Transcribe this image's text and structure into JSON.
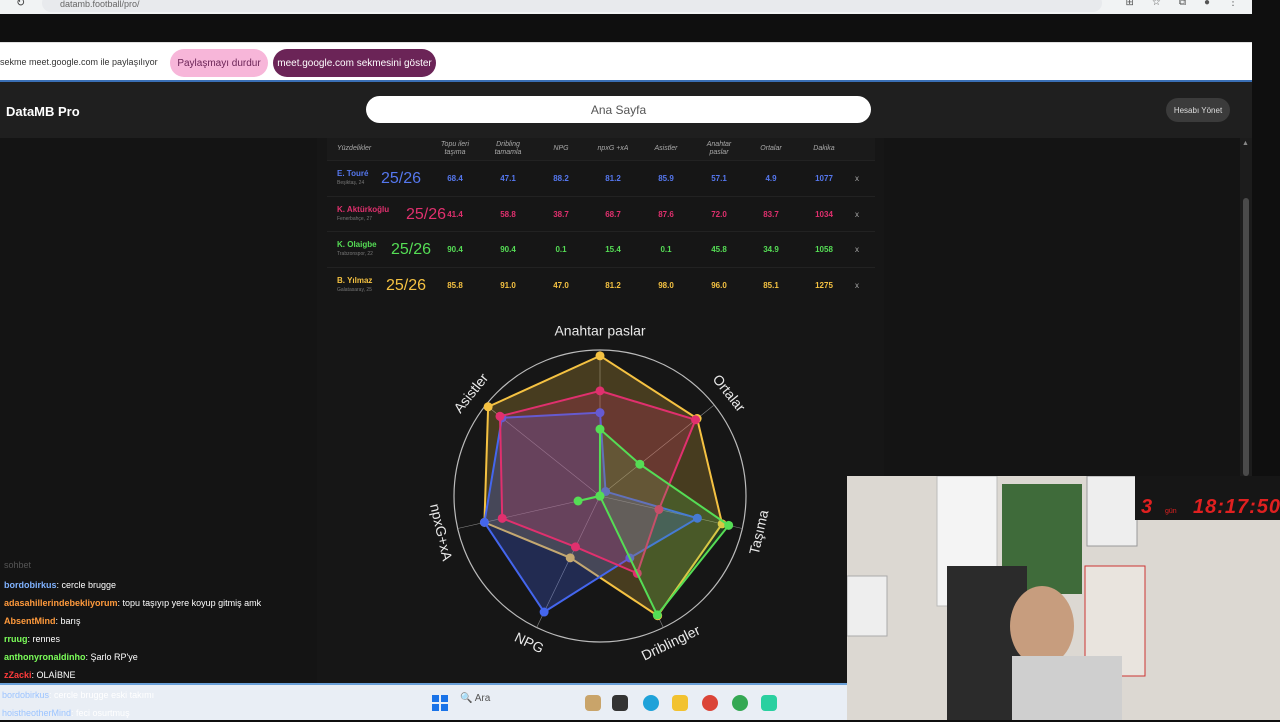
{
  "browser": {
    "url": "datamb.football/pro/"
  },
  "share_bar": {
    "message": "sekme meet.google.com ile paylaşılıyor",
    "stop_label": "Paylaşmayı durdur",
    "show_label": "meet.google.com sekmesini göster"
  },
  "app": {
    "brand": "DataMB Pro",
    "search_text": "Ana Sayfa",
    "manage_label": "Hesabı Yönet"
  },
  "table": {
    "corner_label": "Yüzdelikler",
    "columns": [
      "Topu ileri taşıma",
      "Dribling tamamla",
      "NPG",
      "npxG +xA",
      "Asistler",
      "Anahtar paslar",
      "Ortalar",
      "Dakika"
    ],
    "rows": [
      {
        "name": "E. Touré",
        "season": "25/26",
        "team": "Beşiktaş, 24",
        "color": "#5577ee",
        "values": [
          "68.4",
          "47.1",
          "88.2",
          "81.2",
          "85.9",
          "57.1",
          "4.9",
          "1077"
        ],
        "remove": "x"
      },
      {
        "name": "K. Aktürkoğlu",
        "season": "25/26",
        "team": "Fenerbahçe, 27",
        "color": "#e0306e",
        "values": [
          "41.4",
          "58.8",
          "38.7",
          "68.7",
          "87.6",
          "72.0",
          "83.7",
          "1034"
        ],
        "remove": "x"
      },
      {
        "name": "K. Olaigbe",
        "season": "25/26",
        "team": "Trabzonspor, 22",
        "color": "#55dd55",
        "values": [
          "90.4",
          "90.4",
          "0.1",
          "15.4",
          "0.1",
          "45.8",
          "34.9",
          "1058"
        ],
        "remove": "x"
      },
      {
        "name": "B. Yılmaz",
        "season": "25/26",
        "team": "Galatasaray, 25",
        "color": "#f5c242",
        "values": [
          "85.8",
          "91.0",
          "47.0",
          "81.2",
          "98.0",
          "96.0",
          "85.1",
          "1275"
        ],
        "remove": "x"
      }
    ]
  },
  "chart_data": {
    "type": "radar",
    "axes": [
      "Anahtar paslar",
      "Ortalar",
      "Taşıma",
      "Driblingler",
      "NPG",
      "npxG+xA",
      "Asistler"
    ],
    "range": [
      0,
      100
    ],
    "grid": true,
    "series": [
      {
        "name": "E. Touré",
        "color": "#4466ee",
        "values": [
          57.1,
          4.9,
          68.4,
          47.1,
          88.2,
          81.2,
          85.9
        ]
      },
      {
        "name": "K. Aktürkoğlu",
        "color": "#e0306e",
        "values": [
          72.0,
          83.7,
          41.4,
          58.8,
          38.7,
          68.7,
          87.6
        ]
      },
      {
        "name": "K. Olaigbe",
        "color": "#55dd55",
        "values": [
          45.8,
          34.9,
          90.4,
          90.4,
          0.1,
          15.4,
          0.1
        ]
      },
      {
        "name": "B. Yılmaz",
        "color": "#f5c242",
        "values": [
          96.0,
          85.1,
          85.8,
          91.0,
          47.0,
          81.2,
          98.0
        ]
      }
    ]
  },
  "chat": {
    "header": "sohbet",
    "lines": [
      {
        "user": "bordobirkus",
        "text": ": cercle brugge",
        "color": "#7fb2ff"
      },
      {
        "user": "adasahillerindebekliyorum",
        "text": ": topu taşıyıp yere koyup gitmiş amk",
        "color": "#ff9a3c"
      },
      {
        "user": "AbsentMind",
        "text": ": barış",
        "color": "#ff9a3c"
      },
      {
        "user": "rruug",
        "text": ": rennes",
        "color": "#7cff5a"
      },
      {
        "user": "anthonyronaldinho",
        "text": ": Şarlo RP'ye",
        "color": "#7cff5a"
      },
      {
        "user": "zZacki",
        "text": ": OLAİBNE",
        "color": "#ff3b3b"
      }
    ],
    "bottom_lines": [
      {
        "user": "bordobirkus",
        "text": ": cercle brugge eski takımı"
      },
      {
        "user": "hoistheotherMind",
        "text": ": feci osurtmuş"
      }
    ]
  },
  "stream": {
    "days": "3",
    "days_label": "gün",
    "clock": "18:17:50"
  },
  "taskbar": {
    "search_placeholder": "Ara"
  }
}
